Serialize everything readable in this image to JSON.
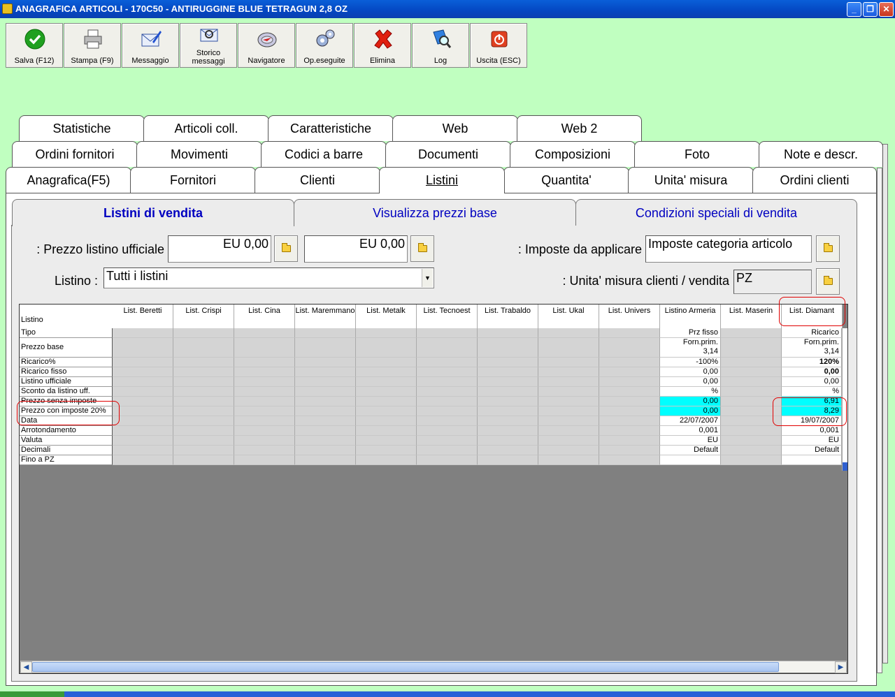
{
  "window": {
    "title": "ANAGRAFICA ARTICOLI - 170C50 - ANTIRUGGINE BLUE TETRAGUN 2,8 OZ",
    "controls": [
      "_",
      "❐",
      "✕"
    ]
  },
  "toolbar": {
    "buttons": [
      {
        "label": "Salva (F12)",
        "icon": "save-check-icon"
      },
      {
        "label": "Stampa (F9)",
        "icon": "printer-icon"
      },
      {
        "label": "Messaggio",
        "icon": "message-icon"
      },
      {
        "label": "Storico messaggi",
        "icon": "message-history-icon"
      },
      {
        "label": "Navigatore",
        "icon": "navigator-icon"
      },
      {
        "label": "Op.eseguite",
        "icon": "operations-icon"
      },
      {
        "label": "Elimina",
        "icon": "delete-icon"
      },
      {
        "label": "Log",
        "icon": "log-icon"
      },
      {
        "label": "Uscita (ESC)",
        "icon": "exit-icon"
      }
    ],
    "storico_line1": "Storico",
    "storico_line2": "messaggi"
  },
  "tabs": {
    "row1": [
      "Statistiche",
      "Articoli coll.",
      "Caratteristiche",
      "Web",
      "Web 2"
    ],
    "row2": [
      "Ordini fornitori",
      "Movimenti",
      "Codici a barre",
      "Documenti",
      "Composizioni",
      "Foto",
      "Note e descr."
    ],
    "row3": [
      "Anagrafica(F5)",
      "Fornitori",
      "Clienti",
      "Listini",
      "Quantita'",
      "Unita' misura",
      "Ordini clienti"
    ],
    "active": "Listini"
  },
  "subtabs": [
    "Listini di vendita",
    "Visualizza prezzi base",
    "Condizioni speciali di vendita"
  ],
  "form": {
    "prezzo_label": "Prezzo listino ufficiale :",
    "prezzo_value1": "EU 0,00",
    "prezzo_value2": "EU 0,00",
    "imposte_label": "Imposte da applicare :",
    "imposte_value": "Imposte categoria articolo",
    "listino_label": "Listino :",
    "listino_value": "Tutti i listini",
    "unita_label": "Unita' misura clienti / vendita :",
    "unita_value": "PZ"
  },
  "grid": {
    "corner_label": "Listino",
    "columns": [
      "List. Beretti",
      "List. Crispi",
      "List. Cina",
      "List. Maremmano",
      "List. Metalk",
      "List. Tecnoest",
      "List. Trabaldo",
      "List. Ukal",
      "List. Univers",
      "Listino  Armeria",
      "List. Maserin",
      "List. Diamant"
    ],
    "rows": [
      "Tipo",
      "Prezzo base",
      "Ricarico%",
      "Ricarico fisso",
      "Listino ufficiale",
      "Sconto da listino uff.",
      "Prezzo senza imposte",
      "Prezzo con imposte 20%",
      "Data",
      "Arrotondamento",
      "Valuta",
      "Decimali",
      "Fino a PZ"
    ],
    "armeria": [
      "Prz fisso",
      "Forn.prim.",
      "3,14",
      "-100%",
      "0,00",
      "0,00",
      "%",
      "0,00",
      "0,00",
      "22/07/2007",
      "0,001",
      "EU",
      "Default",
      ""
    ],
    "diamant": [
      "Ricarico",
      "Forn.prim.",
      "3,14",
      "120%",
      "0,00",
      "0,00",
      "%",
      "6,91",
      "8,29",
      "19/07/2007",
      "0,001",
      "EU",
      "Default",
      ""
    ]
  },
  "colors": {
    "background": "#c0ffc0",
    "highlight": "#00ffff",
    "annotation": "#e00000",
    "tab_text_blue": "#0000c0"
  }
}
